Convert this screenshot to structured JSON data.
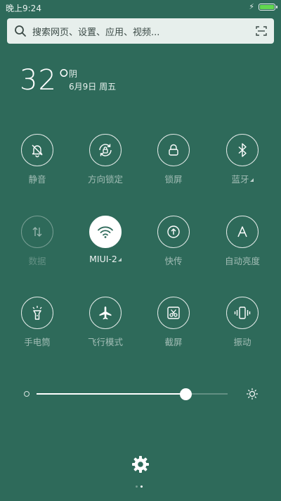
{
  "status_bar": {
    "time": "晚上9:24",
    "battery_level": 1.0
  },
  "search": {
    "placeholder": "搜索网页、设置、应用、视频..."
  },
  "weather": {
    "temperature": "32°",
    "condition": "阴",
    "date": "6月9日 周五"
  },
  "toggles": [
    {
      "label": "静音",
      "icon": "bell-off-icon",
      "state": "off"
    },
    {
      "label": "方向锁定",
      "icon": "rotation-lock-icon",
      "state": "off"
    },
    {
      "label": "锁屏",
      "icon": "lock-icon",
      "state": "off"
    },
    {
      "label": "蓝牙",
      "icon": "bluetooth-icon",
      "state": "off",
      "has_menu": true
    },
    {
      "label": "数据",
      "icon": "mobile-data-icon",
      "state": "disabled"
    },
    {
      "label": "MIUI-2",
      "icon": "wifi-icon",
      "state": "on",
      "has_menu": true
    },
    {
      "label": "快传",
      "icon": "quick-transfer-icon",
      "state": "off"
    },
    {
      "label": "自动亮度",
      "icon": "auto-brightness-icon",
      "state": "off"
    },
    {
      "label": "手电筒",
      "icon": "flashlight-icon",
      "state": "off"
    },
    {
      "label": "飞行模式",
      "icon": "airplane-icon",
      "state": "off"
    },
    {
      "label": "截屏",
      "icon": "screenshot-icon",
      "state": "off"
    },
    {
      "label": "振动",
      "icon": "vibrate-icon",
      "state": "off"
    }
  ],
  "brightness": {
    "level": 0.78
  },
  "pager": {
    "pages": 2,
    "current": 2
  },
  "colors": {
    "background": "#2e6a5a",
    "accent": "#ffffff",
    "battery": "#62d84f"
  }
}
